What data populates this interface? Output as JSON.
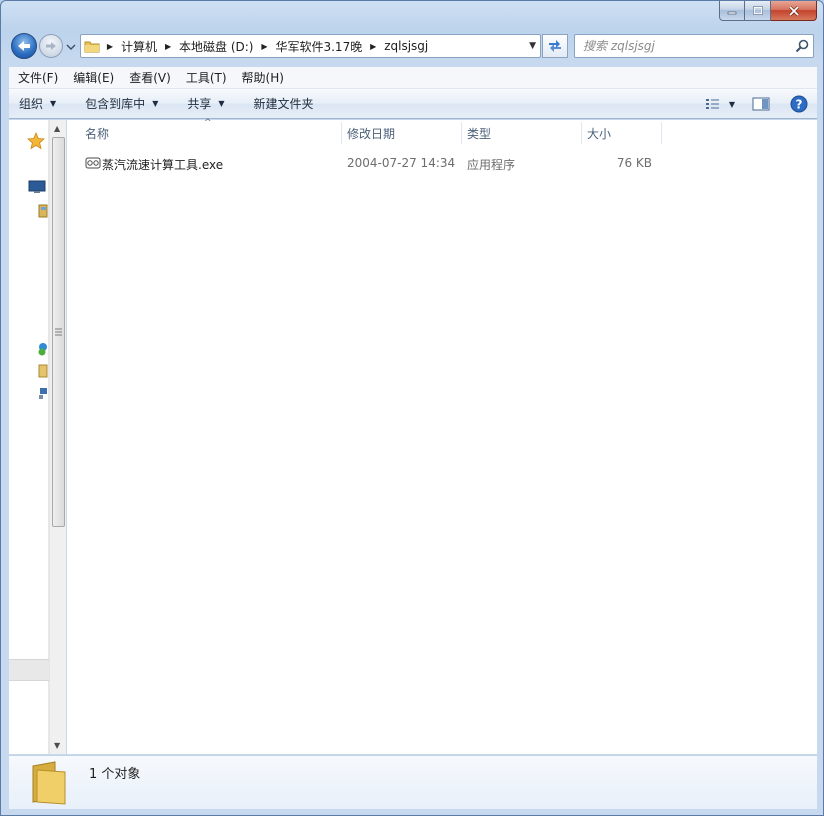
{
  "window": {
    "caption": {
      "minimize": "minimize",
      "maximize": "maximize",
      "close": "close"
    }
  },
  "address": {
    "crumbs": [
      "计算机",
      "本地磁盘 (D:)",
      "华军软件3.17晚",
      "zqlsjsgj"
    ]
  },
  "search": {
    "placeholder": "搜索 zqlsjsgj"
  },
  "menu": [
    "文件(F)",
    "编辑(E)",
    "查看(V)",
    "工具(T)",
    "帮助(H)"
  ],
  "toolbar": {
    "organize": "组织",
    "include_in_library": "包含到库中",
    "share": "共享",
    "new_folder": "新建文件夹"
  },
  "columns": {
    "name": "名称",
    "date": "修改日期",
    "type": "类型",
    "size": "大小"
  },
  "files": [
    {
      "name": "蒸汽流速计算工具.exe",
      "date": "2004-07-27 14:34",
      "type": "应用程序",
      "size": "76 KB"
    }
  ],
  "status": {
    "count": "1 个对象"
  },
  "icons": {
    "back": "back-arrow-icon",
    "forward": "forward-arrow-icon",
    "folder": "folder-icon",
    "refresh": "refresh-icon",
    "search": "search-icon",
    "views": "view-options-icon",
    "preview": "preview-pane-icon",
    "help": "help-icon",
    "favorites": "star-icon"
  },
  "colors": {
    "accent": "#2b6cc0",
    "close": "#c4422b",
    "frame": "#bcd3ec"
  }
}
